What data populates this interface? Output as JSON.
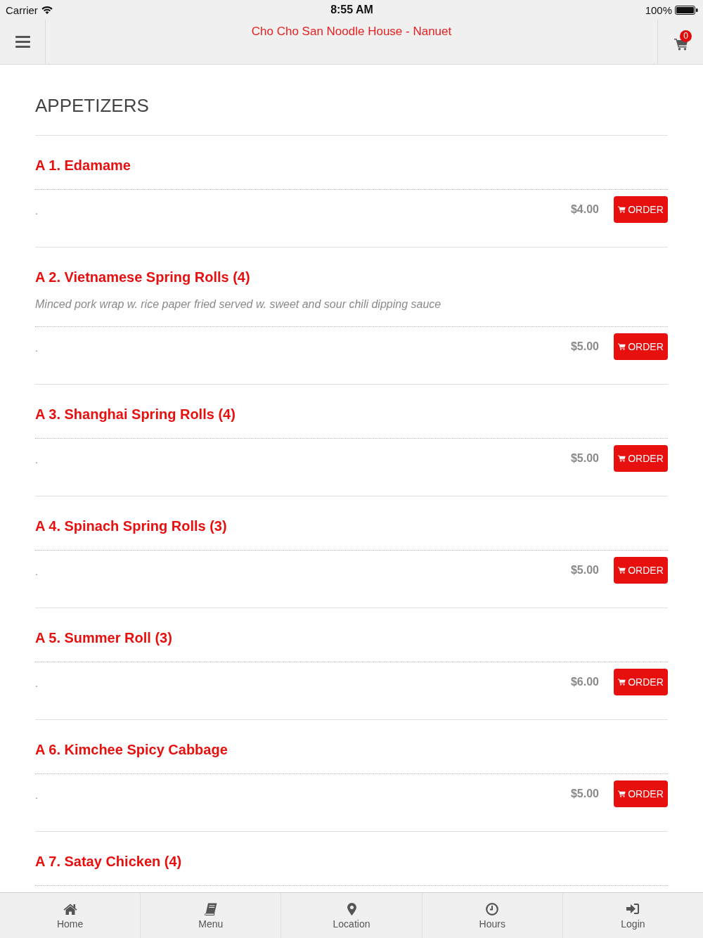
{
  "status_bar": {
    "carrier": "Carrier",
    "time": "8:55 AM",
    "battery": "100%"
  },
  "nav_bar": {
    "title": "Cho Cho San Noodle House - Nanuet",
    "cart_count": "0"
  },
  "section": {
    "title": "APPETIZERS",
    "items": [
      {
        "name": "A 1. Edamame",
        "note": ".",
        "price": "$4.00",
        "button": "ORDER"
      },
      {
        "name": "A 2. Vietnamese Spring Rolls (4)",
        "description": "Minced pork wrap w. rice paper fried served w. sweet and sour chili dipping sauce",
        "note": ".",
        "price": "$5.00",
        "button": "ORDER"
      },
      {
        "name": "A 3. Shanghai Spring Rolls (4)",
        "note": ".",
        "price": "$5.00",
        "button": "ORDER"
      },
      {
        "name": "A 4. Spinach Spring Rolls (3)",
        "note": ".",
        "price": "$5.00",
        "button": "ORDER"
      },
      {
        "name": "A 5. Summer Roll (3)",
        "note": ".",
        "price": "$6.00",
        "button": "ORDER"
      },
      {
        "name": "A 6. Kimchee Spicy Cabbage",
        "note": ".",
        "price": "$5.00",
        "button": "ORDER"
      },
      {
        "name": "A 7. Satay Chicken (4)"
      }
    ]
  },
  "tab_bar": [
    {
      "kind": "home",
      "label": "Home"
    },
    {
      "kind": "menu",
      "label": "Menu"
    },
    {
      "kind": "location",
      "label": "Location"
    },
    {
      "kind": "hours",
      "label": "Hours"
    },
    {
      "kind": "login",
      "label": "Login"
    }
  ]
}
